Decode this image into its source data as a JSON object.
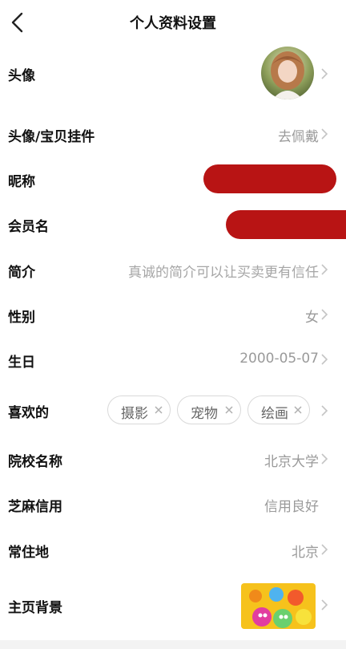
{
  "header": {
    "title": "个人资料设置"
  },
  "rows": {
    "avatar": {
      "label": "头像"
    },
    "pendant": {
      "label": "头像/宝贝挂件",
      "value": "去佩戴"
    },
    "nickname": {
      "label": "昵称"
    },
    "member": {
      "label": "会员名"
    },
    "bio": {
      "label": "简介",
      "placeholder": "真诚的简介可以让买卖更有信任"
    },
    "gender": {
      "label": "性别",
      "value": "女"
    },
    "birthday": {
      "label": "生日",
      "value": "2000-05-07"
    },
    "likes": {
      "label": "喜欢的",
      "tags": [
        "摄影",
        "宠物",
        "绘画"
      ]
    },
    "school": {
      "label": "院校名称",
      "value": "北京大学"
    },
    "sesame": {
      "label": "芝麻信用",
      "value": "信用良好"
    },
    "residence": {
      "label": "常住地",
      "value": "北京"
    },
    "background": {
      "label": "主页背景"
    }
  },
  "colors": {
    "redaction": "#b81414",
    "label": "#111111",
    "muted": "#9a9a9a"
  }
}
